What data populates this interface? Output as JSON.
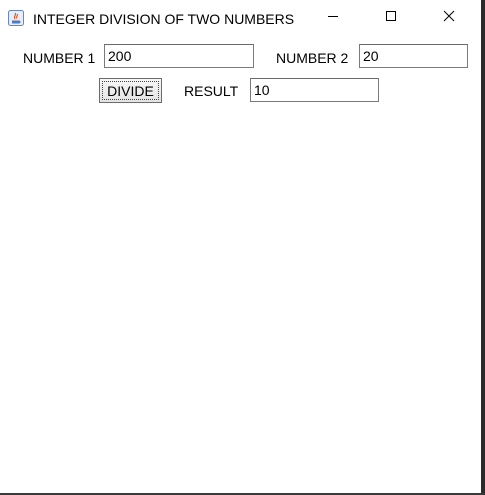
{
  "window": {
    "title": "INTEGER DIVISION OF TWO NUMBERS",
    "app_icon": "java-icon",
    "controls": [
      "minimize-icon",
      "maximize-icon",
      "close-icon"
    ]
  },
  "form": {
    "number1": {
      "label": "NUMBER 1",
      "value": "200"
    },
    "number2": {
      "label": "NUMBER 2",
      "value": "20"
    },
    "divide_button": {
      "label": "DIVIDE"
    },
    "result": {
      "label": "RESULT",
      "value": "10"
    }
  },
  "colors": {
    "window_bg": "#ffffff",
    "field_border": "#7a7a7a",
    "button_border": "#6d6d6d"
  }
}
